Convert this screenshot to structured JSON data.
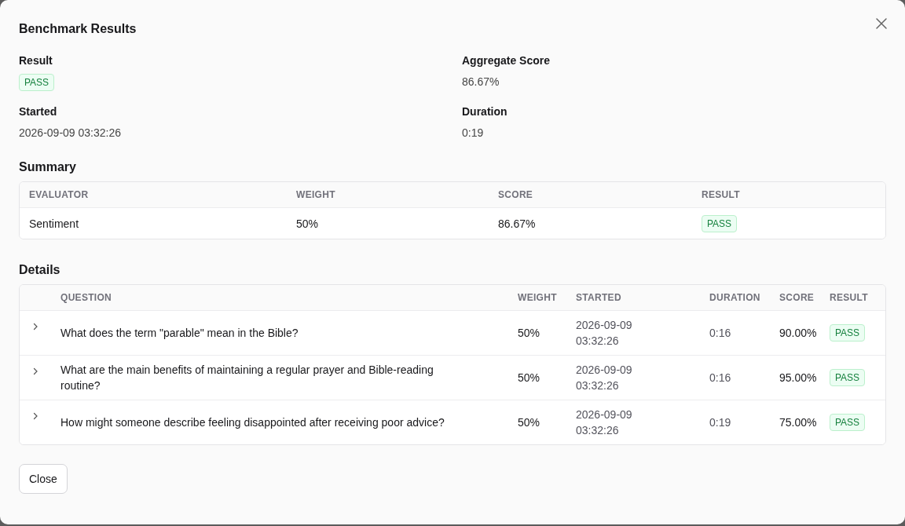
{
  "dialog": {
    "title": "Benchmark Results"
  },
  "fields": [
    {
      "label": "Result",
      "value": "PASS",
      "kind": "badge"
    },
    {
      "label": "Aggregate Score",
      "value": "86.67%",
      "kind": "text"
    },
    {
      "label": "Started",
      "value": "2026-09-09 03:32:26",
      "kind": "text"
    },
    {
      "label": "Duration",
      "value": "0:19",
      "kind": "text"
    }
  ],
  "summary": {
    "heading": "Summary",
    "columns": [
      "EVALUATOR",
      "WEIGHT",
      "SCORE",
      "RESULT"
    ],
    "rows": [
      {
        "evaluator": "Sentiment",
        "weight": "50%",
        "score": "86.67%",
        "result": "PASS"
      }
    ]
  },
  "details": {
    "heading": "Details",
    "columns": [
      "QUESTION",
      "WEIGHT",
      "STARTED",
      "DURATION",
      "SCORE",
      "RESULT"
    ],
    "rows": [
      {
        "expanded": false,
        "question": "What does the term \"parable\" mean in the Bible?",
        "weight": "50%",
        "started": "2026-09-09 03:32:26",
        "duration": "0:16",
        "score": "90.00%",
        "result": "PASS"
      },
      {
        "expanded": false,
        "question": "What are the main benefits of maintaining a regular prayer and Bible-reading routine?",
        "weight": "50%",
        "started": "2026-09-09 03:32:26",
        "duration": "0:16",
        "score": "95.00%",
        "result": "PASS"
      },
      {
        "expanded": false,
        "question": "How might someone describe feeling disappointed after receiving poor advice?",
        "weight": "50%",
        "started": "2026-09-09 03:32:26",
        "duration": "0:19",
        "score": "75.00%",
        "result": "PASS"
      }
    ]
  },
  "buttons": [
    "Close"
  ]
}
